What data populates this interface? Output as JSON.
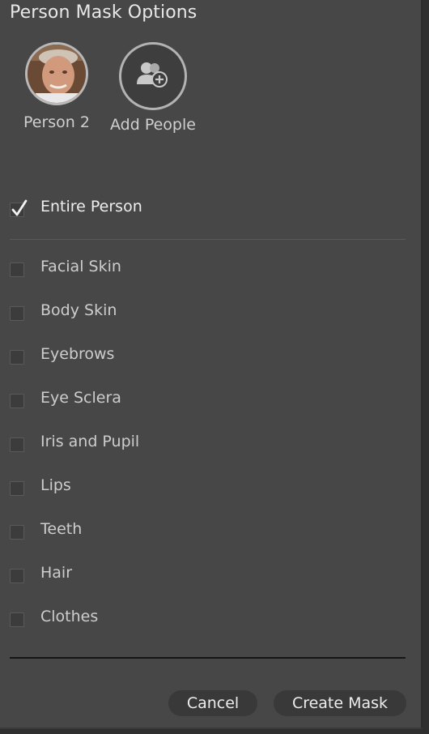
{
  "panel": {
    "title": "Person Mask Options"
  },
  "people": [
    {
      "label": "Person 2",
      "kind": "face-thumbnail"
    },
    {
      "label": "Add People",
      "icon": "add-person-icon"
    }
  ],
  "entire_person": {
    "label": "Entire Person",
    "checked": true
  },
  "parts": [
    {
      "label": "Facial Skin",
      "checked": false
    },
    {
      "label": "Body Skin",
      "checked": false
    },
    {
      "label": "Eyebrows",
      "checked": false
    },
    {
      "label": "Eye Sclera",
      "checked": false
    },
    {
      "label": "Iris and Pupil",
      "checked": false
    },
    {
      "label": "Lips",
      "checked": false
    },
    {
      "label": "Teeth",
      "checked": false
    },
    {
      "label": "Hair",
      "checked": false
    },
    {
      "label": "Clothes",
      "checked": false
    }
  ],
  "buttons": {
    "cancel": "Cancel",
    "create": "Create Mask"
  },
  "colors": {
    "panel_bg": "#474747",
    "text": "#cdcdcd",
    "button_bg": "#393939"
  }
}
